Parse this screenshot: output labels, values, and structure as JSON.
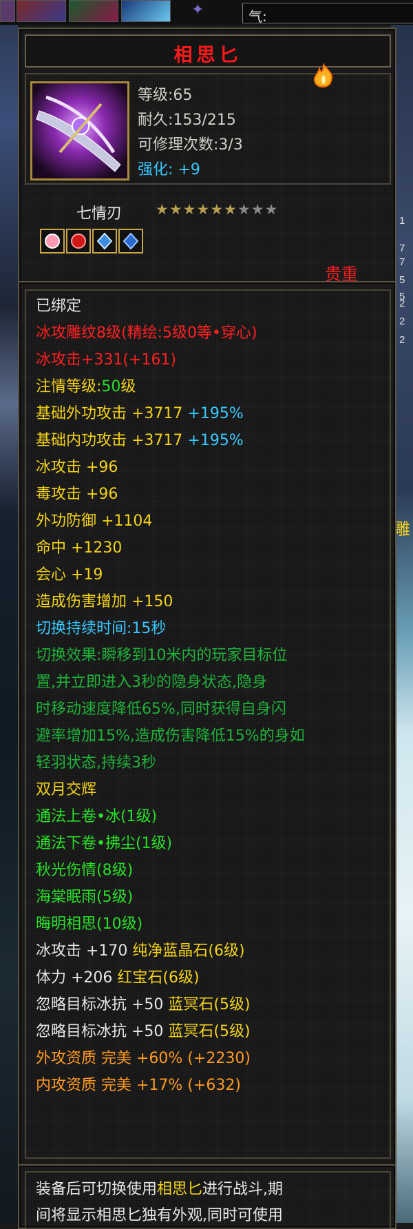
{
  "topbar": {
    "qi_label": "气:"
  },
  "side_numbers": [
    "1",
    "7",
    "7",
    "5",
    "5",
    "2",
    "2",
    "2"
  ],
  "side_decor": "雕",
  "item": {
    "name": "相思匕",
    "level_label": "等级:",
    "level": "65",
    "durability_label": "耐久:",
    "durability": "153/215",
    "repair_label": "可修理次数:",
    "repairs": "3/3",
    "enhance_label": "强化: ",
    "enhance": "+9"
  },
  "set": {
    "name": "七情刃",
    "stars_filled": 6,
    "stars_total": 9
  },
  "gems": [
    {
      "color": "#ff6a6a"
    },
    {
      "color": "#e01818"
    },
    {
      "color": "#3a8ce0"
    },
    {
      "color": "#3a7ad0"
    }
  ],
  "rarity": "贵重",
  "stats": [
    {
      "parts": [
        {
          "t": "已绑定",
          "c": "c-white"
        }
      ]
    },
    {
      "parts": [
        {
          "t": "冰攻雕纹8级(精绘:5级0等•穿心)",
          "c": "c-red"
        }
      ]
    },
    {
      "parts": [
        {
          "t": "冰攻击+331(+161)",
          "c": "c-red"
        }
      ]
    },
    {
      "parts": [
        {
          "t": "注情等级:",
          "c": "c-yellow"
        },
        {
          "t": "50",
          "c": "c-green"
        },
        {
          "t": "级",
          "c": "c-yellow"
        }
      ]
    },
    {
      "parts": [
        {
          "t": "基础外功攻击 +3717 ",
          "c": "c-yellow"
        },
        {
          "t": "+195%",
          "c": "c-cyan"
        }
      ]
    },
    {
      "parts": [
        {
          "t": "基础内功攻击 +3717 ",
          "c": "c-yellow"
        },
        {
          "t": "+195%",
          "c": "c-cyan"
        }
      ]
    },
    {
      "parts": [
        {
          "t": "冰攻击 +96",
          "c": "c-yellow"
        }
      ]
    },
    {
      "parts": [
        {
          "t": "毒攻击 +96",
          "c": "c-yellow"
        }
      ]
    },
    {
      "parts": [
        {
          "t": "外功防御 +1104",
          "c": "c-yellow"
        }
      ]
    },
    {
      "parts": [
        {
          "t": "命中 +1230",
          "c": "c-yellow"
        }
      ]
    },
    {
      "parts": [
        {
          "t": "会心 +19",
          "c": "c-yellow"
        }
      ]
    },
    {
      "parts": [
        {
          "t": "造成伤害增加 +150",
          "c": "c-yellow"
        }
      ]
    },
    {
      "parts": [
        {
          "t": "切换持续时间:",
          "c": "c-cyan"
        },
        {
          "t": "15秒",
          "c": "c-cyan"
        }
      ]
    },
    {
      "parts": [
        {
          "t": "切换效果:瞬移到10米内的玩家目标位",
          "c": "c-dgreen"
        }
      ]
    },
    {
      "parts": [
        {
          "t": "置,并立即进入3秒的隐身状态,隐身",
          "c": "c-dgreen"
        }
      ]
    },
    {
      "parts": [
        {
          "t": "时移动速度降低65%,同时获得自身闪",
          "c": "c-dgreen"
        }
      ]
    },
    {
      "parts": [
        {
          "t": "避率增加15%,造成伤害降低15%的身如",
          "c": "c-dgreen"
        }
      ]
    },
    {
      "parts": [
        {
          "t": "轻羽状态,持续3秒",
          "c": "c-dgreen"
        }
      ]
    },
    {
      "parts": [
        {
          "t": "双月交辉",
          "c": "c-yellow"
        }
      ]
    },
    {
      "parts": [
        {
          "t": "通法上卷•冰(1级)",
          "c": "c-green"
        }
      ]
    },
    {
      "parts": [
        {
          "t": "通法下卷•拂尘(1级)",
          "c": "c-green"
        }
      ]
    },
    {
      "parts": [
        {
          "t": "秋光伤情(8级)",
          "c": "c-green"
        }
      ]
    },
    {
      "parts": [
        {
          "t": "海棠眠雨(5级)",
          "c": "c-green"
        }
      ]
    },
    {
      "parts": [
        {
          "t": "晦明相思(10级)",
          "c": "c-green"
        }
      ]
    },
    {
      "parts": [
        {
          "t": "冰攻击 +170 ",
          "c": "c-white"
        },
        {
          "t": "纯净蓝晶石(6级)",
          "c": "c-gem"
        }
      ]
    },
    {
      "parts": [
        {
          "t": "体力 +206 ",
          "c": "c-white"
        },
        {
          "t": "红宝石(6级)",
          "c": "c-gem"
        }
      ]
    },
    {
      "parts": [
        {
          "t": "忽略目标冰抗 +50 ",
          "c": "c-white"
        },
        {
          "t": "蓝冥石(5级)",
          "c": "c-gem"
        }
      ]
    },
    {
      "parts": [
        {
          "t": "忽略目标冰抗 +50 ",
          "c": "c-white"
        },
        {
          "t": "蓝冥石(5级)",
          "c": "c-gem"
        }
      ]
    },
    {
      "parts": [
        {
          "t": "外攻资质  完美 +60% (+2230)",
          "c": "c-orange"
        }
      ]
    },
    {
      "parts": [
        {
          "t": "内攻资质  完美 +17% (+632)",
          "c": "c-orange"
        }
      ]
    }
  ],
  "description": {
    "line1_a": "装备后可切换使用",
    "line1_b": "相思匕",
    "line1_c": "进行战斗,期",
    "line2": "间将显示相思匕独有外观,同时可使用"
  },
  "colors": {
    "title": "#ff1a1a",
    "border": "#5c5444",
    "star_on": "#b8a050",
    "star_off": "#8a8a8a"
  }
}
